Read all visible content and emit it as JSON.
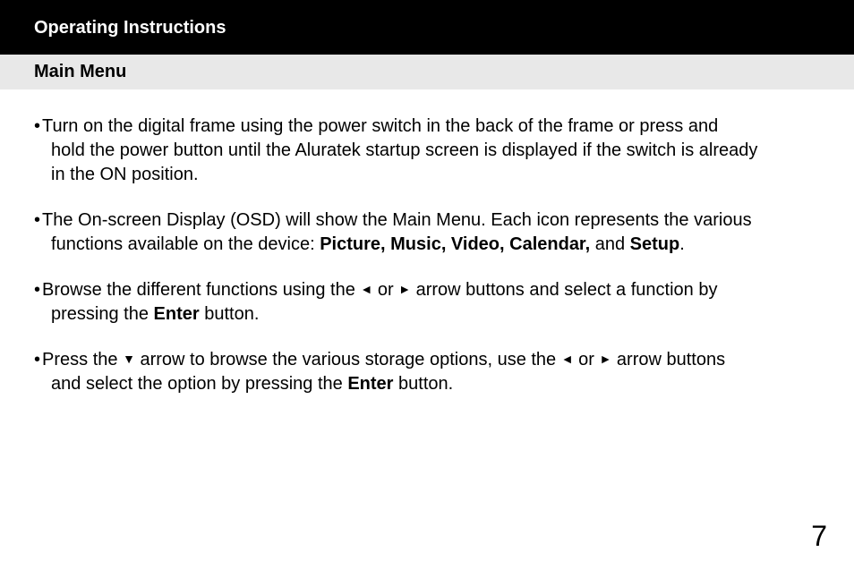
{
  "header": {
    "title": "Operating Instructions"
  },
  "subheader": {
    "title": "Main Menu"
  },
  "bullets": {
    "b1_line1": "Turn on the digital frame using the power switch in the back of the frame or press and",
    "b1_line2": "hold the power button until the Aluratek startup screen is displayed if the switch is already",
    "b1_line3": "in the ON position.",
    "b2_line1": "The On-screen Display (OSD) will show the Main Menu. Each icon represents the various",
    "b2_line2_pre": "functions available on the device: ",
    "b2_bold": "Picture, Music, Video, Calendar,",
    "b2_and": " and ",
    "b2_setup": "Setup",
    "b2_period": ".",
    "b3_pre": "Browse the different functions using the ",
    "b3_mid": " or ",
    "b3_post": " arrow buttons and select a function by",
    "b3_line2_pre": "pressing the ",
    "b3_enter": "Enter",
    "b3_line2_post": " button.",
    "b4_pre": "Press the ",
    "b4_mid1": " arrow to browse the various storage options, use the ",
    "b4_mid2": " or ",
    "b4_post": " arrow buttons",
    "b4_line2_pre": "and select the option by pressing the ",
    "b4_enter": "Enter",
    "b4_line2_post": " button."
  },
  "arrows": {
    "left": "◄",
    "right": "►",
    "down": "▼"
  },
  "bullet_marker": "• ",
  "page_number": "7"
}
